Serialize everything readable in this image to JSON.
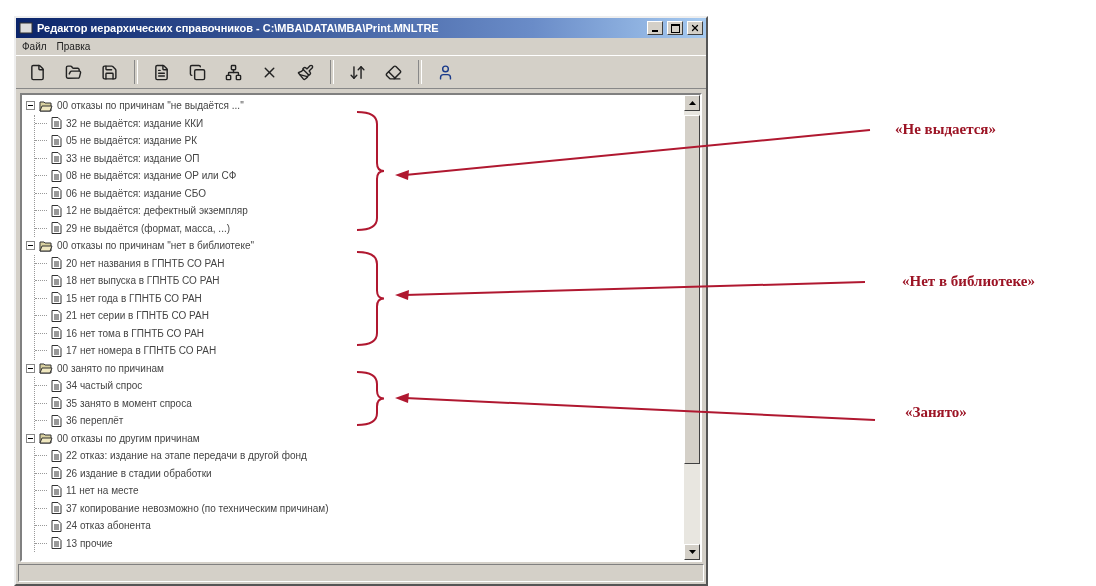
{
  "window": {
    "title": "Редактор иерархических справочников - C:\\MBA\\DATA\\MBA\\Print.MNLTRE"
  },
  "menu": [
    "Файл",
    "Правка"
  ],
  "tree": [
    {
      "label": "00 отказы по причинам \"не выдаётся ...\"",
      "expanded": true,
      "children": [
        {
          "label": "32 не выдаётся: издание ККИ"
        },
        {
          "label": "05 не выдаётся: издание РК"
        },
        {
          "label": "33 не выдаётся: издание ОП"
        },
        {
          "label": "08 не выдаётся: издание ОР или СФ"
        },
        {
          "label": "06 не выдаётся: издание СБО"
        },
        {
          "label": "12 не выдаётся: дефектный экземпляр"
        },
        {
          "label": "29 не выдаётся (формат, масса, ...)"
        }
      ]
    },
    {
      "label": "00 отказы по причинам \"нет в библиотеке\"",
      "expanded": true,
      "children": [
        {
          "label": "20 нет названия в ГПНТБ СО РАН"
        },
        {
          "label": "18 нет выпуска в ГПНТБ СО РАН"
        },
        {
          "label": "15 нет года в ГПНТБ СО РАН"
        },
        {
          "label": "21 нет серии в ГПНТБ СО РАН"
        },
        {
          "label": "16 нет тома в ГПНТБ СО РАН"
        },
        {
          "label": "17 нет номера в ГПНТБ СО РАН"
        }
      ]
    },
    {
      "label": "00 занято по причинам",
      "expanded": true,
      "children": [
        {
          "label": "34 частый спрос"
        },
        {
          "label": "35 занято в момент спроса"
        },
        {
          "label": "36 переплёт"
        }
      ]
    },
    {
      "label": "00 отказы по другим причинам",
      "expanded": true,
      "children": [
        {
          "label": "22 отказ: издание на этапе передачи в другой фонд"
        },
        {
          "label": "26 издание в стадии обработки"
        },
        {
          "label": "11 нет на месте"
        },
        {
          "label": "37 копирование невозможно (по техническим причинам)"
        },
        {
          "label": "24 отказ абонента"
        },
        {
          "label": "13 прочие"
        }
      ]
    }
  ],
  "annotations": [
    {
      "label": "«Не выдается»"
    },
    {
      "label": "«Нет в библиотеке»"
    },
    {
      "label": "«Занято»"
    }
  ]
}
